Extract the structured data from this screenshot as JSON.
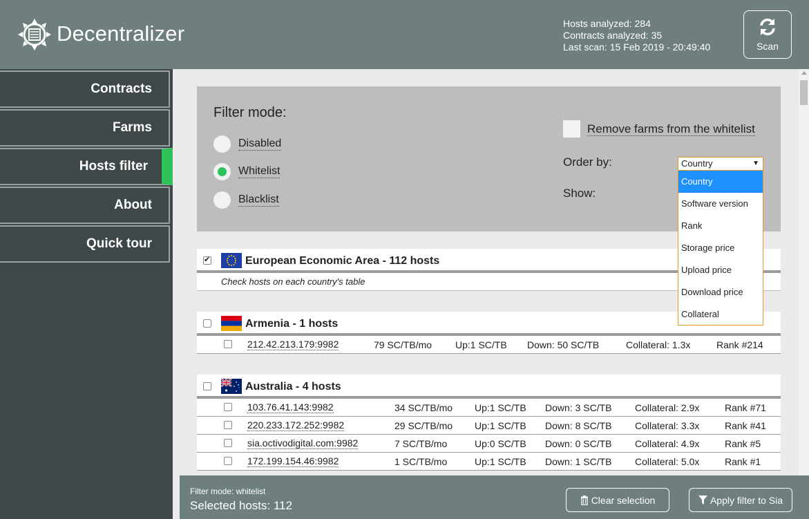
{
  "app": {
    "title": "Decentralizer"
  },
  "stats": {
    "hosts": "Hosts analyzed: 284",
    "contracts": "Contracts analyzed: 35",
    "last_scan": "Last scan: 15 Feb 2019 - 20:49:40"
  },
  "scan_button": {
    "label": "Scan"
  },
  "sidebar": {
    "items": [
      {
        "label": "Contracts"
      },
      {
        "label": "Farms"
      },
      {
        "label": "Hosts filter",
        "active": true
      },
      {
        "label": "About"
      },
      {
        "label": "Quick tour"
      }
    ]
  },
  "filter": {
    "title": "Filter mode:",
    "modes": [
      {
        "label": "Disabled",
        "checked": false
      },
      {
        "label": "Whitelist",
        "checked": true
      },
      {
        "label": "Blacklist",
        "checked": false
      }
    ],
    "remove_farms_label": "Remove farms from the whitelist",
    "order_by_label": "Order by:",
    "show_label": "Show:",
    "order_by": {
      "selected": "Country",
      "options": [
        "Country",
        "Software version",
        "Rank",
        "Storage price",
        "Upload price",
        "Download price",
        "Collateral"
      ]
    }
  },
  "eea": {
    "name": "European Economic Area - 112 hosts",
    "checked": true,
    "note": "Check hosts on each country's table"
  },
  "countries": [
    {
      "name": "Armenia - 1 hosts",
      "hosts": [
        {
          "address": "212.42.213.179:9982",
          "price": "79 SC/TB/mo",
          "up": "Up:1 SC/TB",
          "down": "Down: 50 SC/TB",
          "collateral": "Collateral: 1.3x",
          "rank": "Rank #214"
        }
      ]
    },
    {
      "name": "Australia - 4 hosts",
      "hosts": [
        {
          "address": "103.76.41.143:9982",
          "price": "34 SC/TB/mo",
          "up": "Up:1 SC/TB",
          "down": "Down: 3 SC/TB",
          "collateral": "Collateral: 2.9x",
          "rank": "Rank #71"
        },
        {
          "address": "220.233.172.252:9982",
          "price": "29 SC/TB/mo",
          "up": "Up:1 SC/TB",
          "down": "Down: 8 SC/TB",
          "collateral": "Collateral: 3.3x",
          "rank": "Rank #41"
        },
        {
          "address": "sia.octivodigital.com:9982",
          "price": "7 SC/TB/mo",
          "up": "Up:0 SC/TB",
          "down": "Down: 0 SC/TB",
          "collateral": "Collateral: 4.9x",
          "rank": "Rank #5"
        },
        {
          "address": "172.199.154.46:9982",
          "price": "1 SC/TB/mo",
          "up": "Up:1 SC/TB",
          "down": "Down: 1 SC/TB",
          "collateral": "Collateral: 5.0x",
          "rank": "Rank #1"
        }
      ]
    }
  ],
  "footer": {
    "mode": "Filter mode: whitelist",
    "selected": "Selected hosts: 112",
    "clear_label": "Clear selection",
    "apply_label": "Apply filter to Sia"
  },
  "colors": {
    "header": "#6e7f7e",
    "sidebar": "#3e4848",
    "accent": "#2dc25a",
    "dropdown_border": "#e39a2c",
    "dropdown_selected": "#1e90ff"
  }
}
